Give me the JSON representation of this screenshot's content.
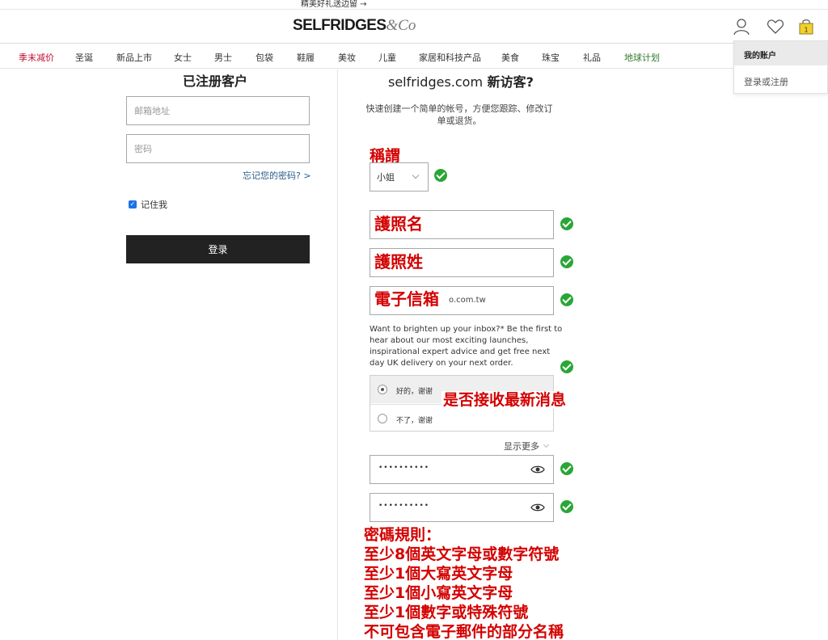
{
  "top_banner": {
    "text": "精美好礼送边留 →"
  },
  "header": {
    "logo_main": "SELFRIDGES",
    "logo_suffix": "&Co",
    "icons": [
      "account-icon",
      "wishlist-heart-icon",
      "shopping-bag-icon"
    ],
    "bag_count": "1"
  },
  "nav": {
    "items": [
      {
        "label": "季末减价",
        "color": "#c0102f"
      },
      {
        "label": "圣诞"
      },
      {
        "label": "新品上市"
      },
      {
        "label": "女士"
      },
      {
        "label": "男士"
      },
      {
        "label": "包袋"
      },
      {
        "label": "鞋履"
      },
      {
        "label": "美妆"
      },
      {
        "label": "儿童"
      },
      {
        "label": "家居和科技产品"
      },
      {
        "label": "美食"
      },
      {
        "label": "珠宝"
      },
      {
        "label": "礼品"
      },
      {
        "label": "地球计划",
        "color": "#2f7a2a"
      }
    ]
  },
  "account_menu": {
    "title": "我的账户",
    "link": "登录或注册"
  },
  "login": {
    "heading": "已注册客户",
    "email_placeholder": "邮箱地址",
    "password_placeholder": "密码",
    "forgot_link": "忘记您的密码? >",
    "remember_label": "记住我",
    "remember_checked": true,
    "submit_label": "登录"
  },
  "register": {
    "heading_domain": "selfridges.com",
    "heading_suffix": " 新访客?",
    "intro": "快速创建一个简单的帐号，方便您跟踪、修改订单或退货。",
    "title_select_value": "小姐",
    "email_value_tail": "o.com.tw",
    "marketing_text": "Want to brighten up your inbox?* Be the first to hear about our most exciting launches, inspirational expert advice and get free next day UK delivery on your next order.",
    "opt_in_yes": "好的，谢谢",
    "opt_in_no": "不了，谢谢",
    "opt_in_selected": "yes",
    "show_more": "显示更多",
    "password_masked": "••••••••••",
    "password_confirm_masked": "••••••••••",
    "valid_color": "#2aa637"
  },
  "annotations": {
    "color": "#d40000",
    "title_label": "稱謂",
    "first_name_label": "護照名",
    "last_name_label": "護照姓",
    "email_label": "電子信箱",
    "subscribe_label": "是否接收最新消息",
    "password_rules": [
      "密碼規則：",
      "至少8個英文字母或數字符號",
      "至少1個大寫英文字母",
      "至少1個小寫英文字母",
      "至少1個數字或特殊符號",
      "不可包含電子郵件的部分名稱"
    ]
  }
}
